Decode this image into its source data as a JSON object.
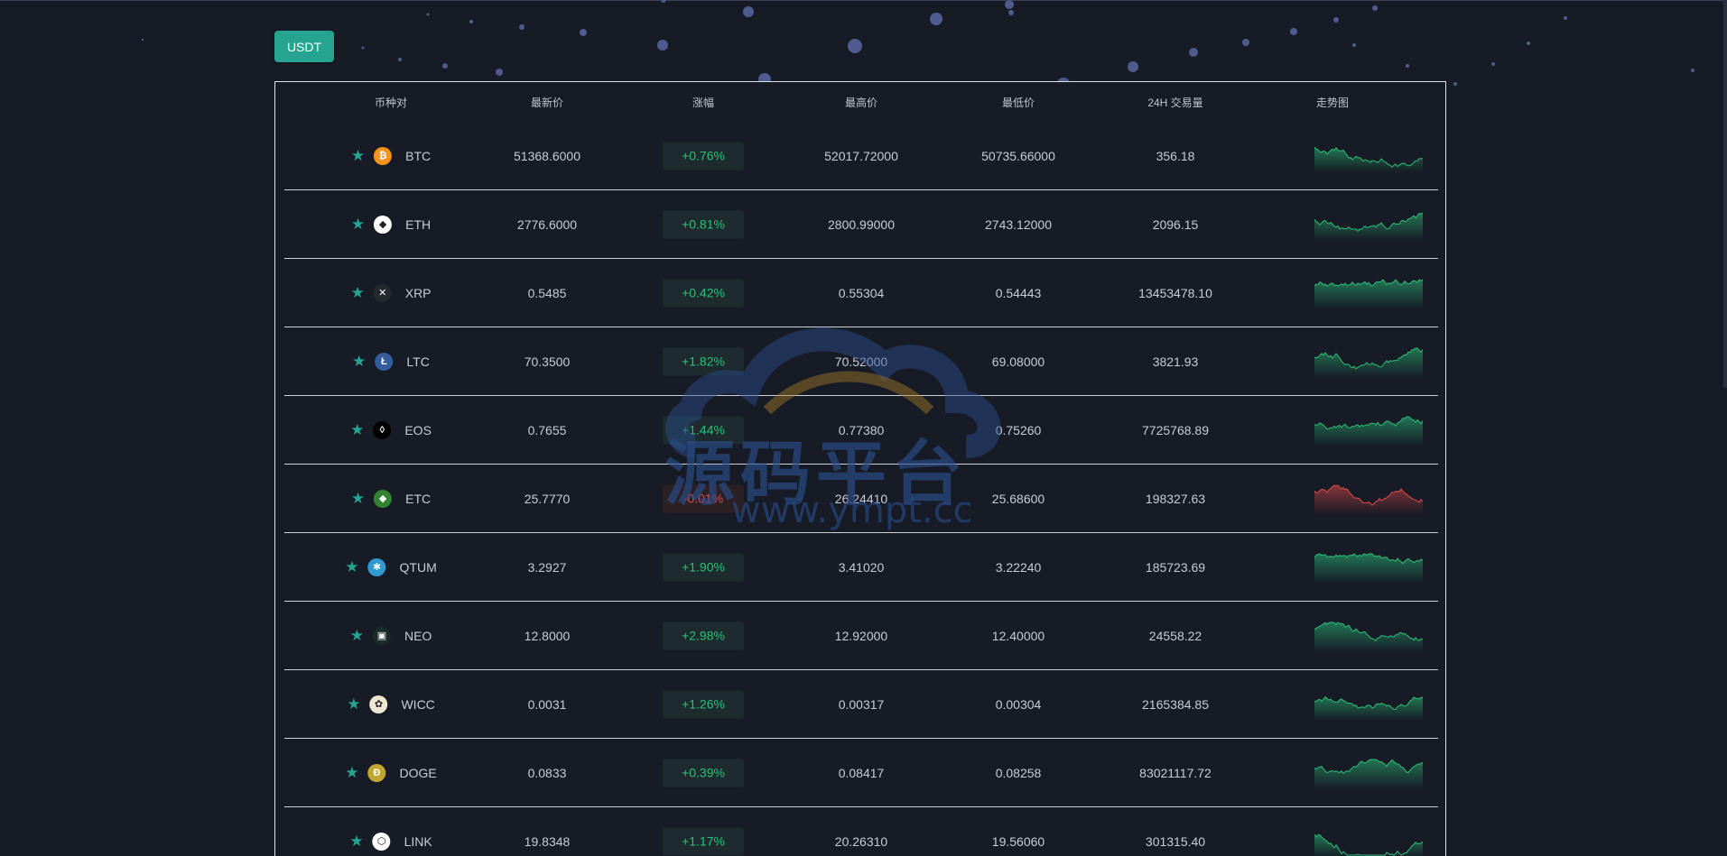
{
  "toolbar": {
    "currency_label": "USDT"
  },
  "table": {
    "headers": {
      "pair": "币种对",
      "last_price": "最新价",
      "change": "涨幅",
      "high": "最高价",
      "low": "最低价",
      "volume": "24H 交易量",
      "trend": "走势图"
    },
    "rows": [
      {
        "symbol": "BTC",
        "price": "51368.6000",
        "change": "+0.76%",
        "direction": "up",
        "high": "52017.72000",
        "low": "50735.66000",
        "volume": "356.18",
        "icon": "bitcoin-icon",
        "icon_color": "#f7931a",
        "icon_glyph": "₿"
      },
      {
        "symbol": "ETH",
        "price": "2776.6000",
        "change": "+0.81%",
        "direction": "up",
        "high": "2800.99000",
        "low": "2743.12000",
        "volume": "2096.15",
        "icon": "ethereum-icon",
        "icon_color": "#ffffff",
        "icon_glyph": "◆"
      },
      {
        "symbol": "XRP",
        "price": "0.5485",
        "change": "+0.42%",
        "direction": "up",
        "high": "0.55304",
        "low": "0.54443",
        "volume": "13453478.10",
        "icon": "xrp-icon",
        "icon_color": "#23292f",
        "icon_glyph": "✕"
      },
      {
        "symbol": "LTC",
        "price": "70.3500",
        "change": "+1.82%",
        "direction": "up",
        "high": "70.52000",
        "low": "69.08000",
        "volume": "3821.93",
        "icon": "litecoin-icon",
        "icon_color": "#345d9d",
        "icon_glyph": "Ł"
      },
      {
        "symbol": "EOS",
        "price": "0.7655",
        "change": "+1.44%",
        "direction": "up",
        "high": "0.77380",
        "low": "0.75260",
        "volume": "7725768.89",
        "icon": "eos-icon",
        "icon_color": "#000000",
        "icon_glyph": "◊"
      },
      {
        "symbol": "ETC",
        "price": "25.7770",
        "change": "-0.01%",
        "direction": "down",
        "high": "26.24410",
        "low": "25.68600",
        "volume": "198327.63",
        "icon": "ethereum-classic-icon",
        "icon_color": "#328332",
        "icon_glyph": "◆"
      },
      {
        "symbol": "QTUM",
        "price": "3.2927",
        "change": "+1.90%",
        "direction": "up",
        "high": "3.41020",
        "low": "3.22240",
        "volume": "185723.69",
        "icon": "qtum-icon",
        "icon_color": "#2e9ad0",
        "icon_glyph": "✱"
      },
      {
        "symbol": "NEO",
        "price": "12.8000",
        "change": "+2.98%",
        "direction": "up",
        "high": "12.92000",
        "low": "12.40000",
        "volume": "24558.22",
        "icon": "neo-icon",
        "icon_color": "#1a2a2a",
        "icon_glyph": "▣"
      },
      {
        "symbol": "WICC",
        "price": "0.0031",
        "change": "+1.26%",
        "direction": "up",
        "high": "0.00317",
        "low": "0.00304",
        "volume": "2165384.85",
        "icon": "wicc-icon",
        "icon_color": "#efe7d2",
        "icon_glyph": "✿"
      },
      {
        "symbol": "DOGE",
        "price": "0.0833",
        "change": "+0.39%",
        "direction": "up",
        "high": "0.08417",
        "low": "0.08258",
        "volume": "83021117.72",
        "icon": "dogecoin-icon",
        "icon_color": "#c2a633",
        "icon_glyph": "Ð"
      },
      {
        "symbol": "LINK",
        "price": "19.8348",
        "change": "+1.17%",
        "direction": "up",
        "high": "20.26310",
        "low": "19.56060",
        "volume": "301315.40",
        "icon": "chainlink-icon",
        "icon_color": "#ffffff",
        "icon_glyph": "⬡"
      }
    ]
  },
  "colors": {
    "background": "#171b26",
    "accent": "#25a58f",
    "up": "#2bc07a",
    "down": "#e04a4a"
  },
  "watermark": {
    "text": "源码平台",
    "url": "www.ympt.cc"
  }
}
